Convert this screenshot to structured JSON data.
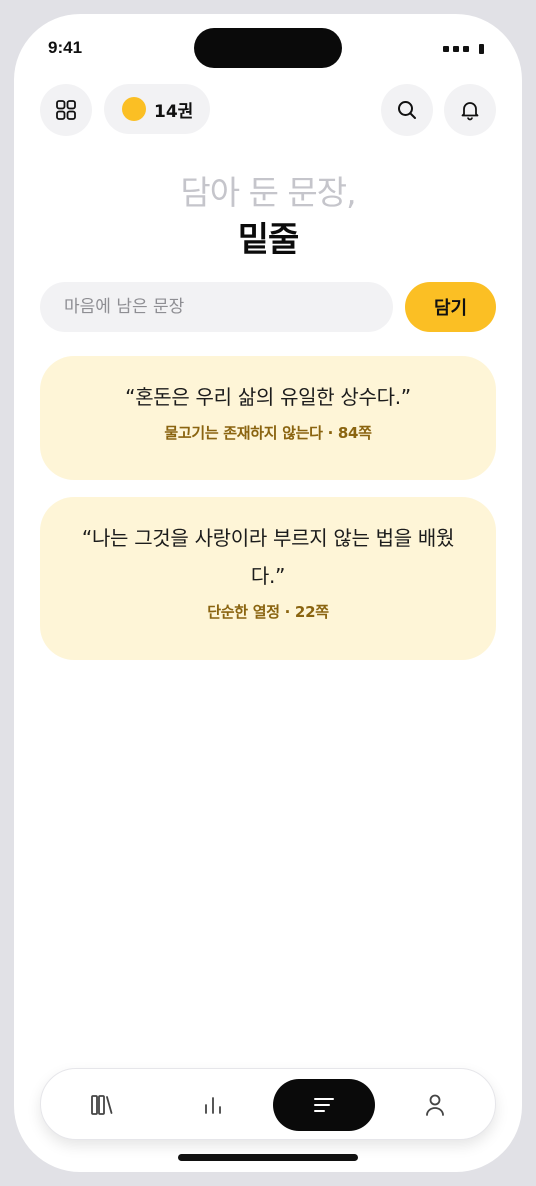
{
  "status": {
    "time": "9:41"
  },
  "header": {
    "credits_label": "14권",
    "menu_icon": "grid-icon",
    "search_icon": "search-icon",
    "notify_icon": "bell-icon"
  },
  "title": {
    "sub": "담아 둔 문장,",
    "main": "밑줄"
  },
  "input": {
    "placeholder": "마음에 남은 문장",
    "value": ""
  },
  "save_button": {
    "label": "담기"
  },
  "quotes": [
    {
      "text": "“혼돈은 우리 삶의 유일한 상수다.”",
      "source": "물고기는 존재하지 않는다 · 84쪽"
    },
    {
      "text": "“나는 그것을 사랑이라 부르지 않는 법을 배웠다.”",
      "source": "단순한 열정 · 22쪽"
    }
  ],
  "tabs": [
    {
      "name": "library",
      "icon": "books-icon",
      "active": false
    },
    {
      "name": "stats",
      "icon": "bar-chart-icon",
      "active": false
    },
    {
      "name": "underlines",
      "icon": "lines-icon",
      "active": true
    },
    {
      "name": "profile",
      "icon": "person-icon",
      "active": false
    }
  ],
  "colors": {
    "accent": "#fbbf24",
    "card_bg": "#fef5d7",
    "source_text": "#8a6410"
  }
}
